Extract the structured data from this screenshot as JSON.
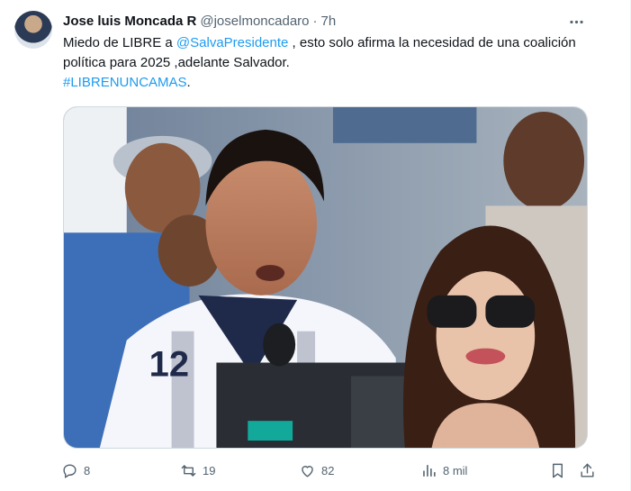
{
  "author": {
    "name": "Jose luis Moncada R",
    "handle": "@joselmoncadaro",
    "separator": "·",
    "time": "7h"
  },
  "tweet": {
    "text_1": "Miedo de LIBRE a ",
    "mention": "@SalvaPresidente",
    "text_2": " ,  esto solo afirma la necesidad de una coalición política para 2025 ,adelante Salvador.",
    "hashtag": "#LIBRENUNCAMAS",
    "text_3": "."
  },
  "media": {
    "jersey_number": "12"
  },
  "actions": {
    "replies": "8",
    "reposts": "19",
    "likes": "82",
    "views": "8 mil"
  },
  "colors": {
    "link": "#1d9bf0",
    "muted": "#536471"
  }
}
